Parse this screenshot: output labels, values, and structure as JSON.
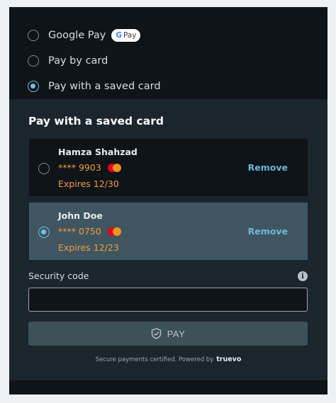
{
  "payment_methods": [
    {
      "label": "Google Pay",
      "badge": "Pay",
      "badge_g": "G",
      "selected": false
    },
    {
      "label": "Pay by card",
      "selected": false
    },
    {
      "label": "Pay with a saved card",
      "selected": true
    }
  ],
  "saved_cards": {
    "title": "Pay with a saved card",
    "cards": [
      {
        "name": "Hamza Shahzad",
        "number": "**** 9903",
        "expiry": "Expires 12/30",
        "remove_label": "Remove",
        "brand_icon": "mastercard-icon",
        "selected": false
      },
      {
        "name": "John Doe",
        "number": "**** 0750",
        "expiry": "Expires 12/23",
        "remove_label": "Remove",
        "brand_icon": "mastercard-icon",
        "selected": true
      }
    ]
  },
  "security": {
    "label": "Security code",
    "value": "",
    "info_glyph": "i"
  },
  "pay_button": {
    "label": "PAY",
    "icon": "shield-check-icon"
  },
  "footer": {
    "text": "Secure payments certified. Powered by",
    "brand": "truevo"
  },
  "colors": {
    "accent": "#6fc3e6",
    "warning_text": "#f39c3d",
    "panel_dark": "#0f1418",
    "panel": "#1b252c",
    "selected_row": "#3f5661"
  }
}
